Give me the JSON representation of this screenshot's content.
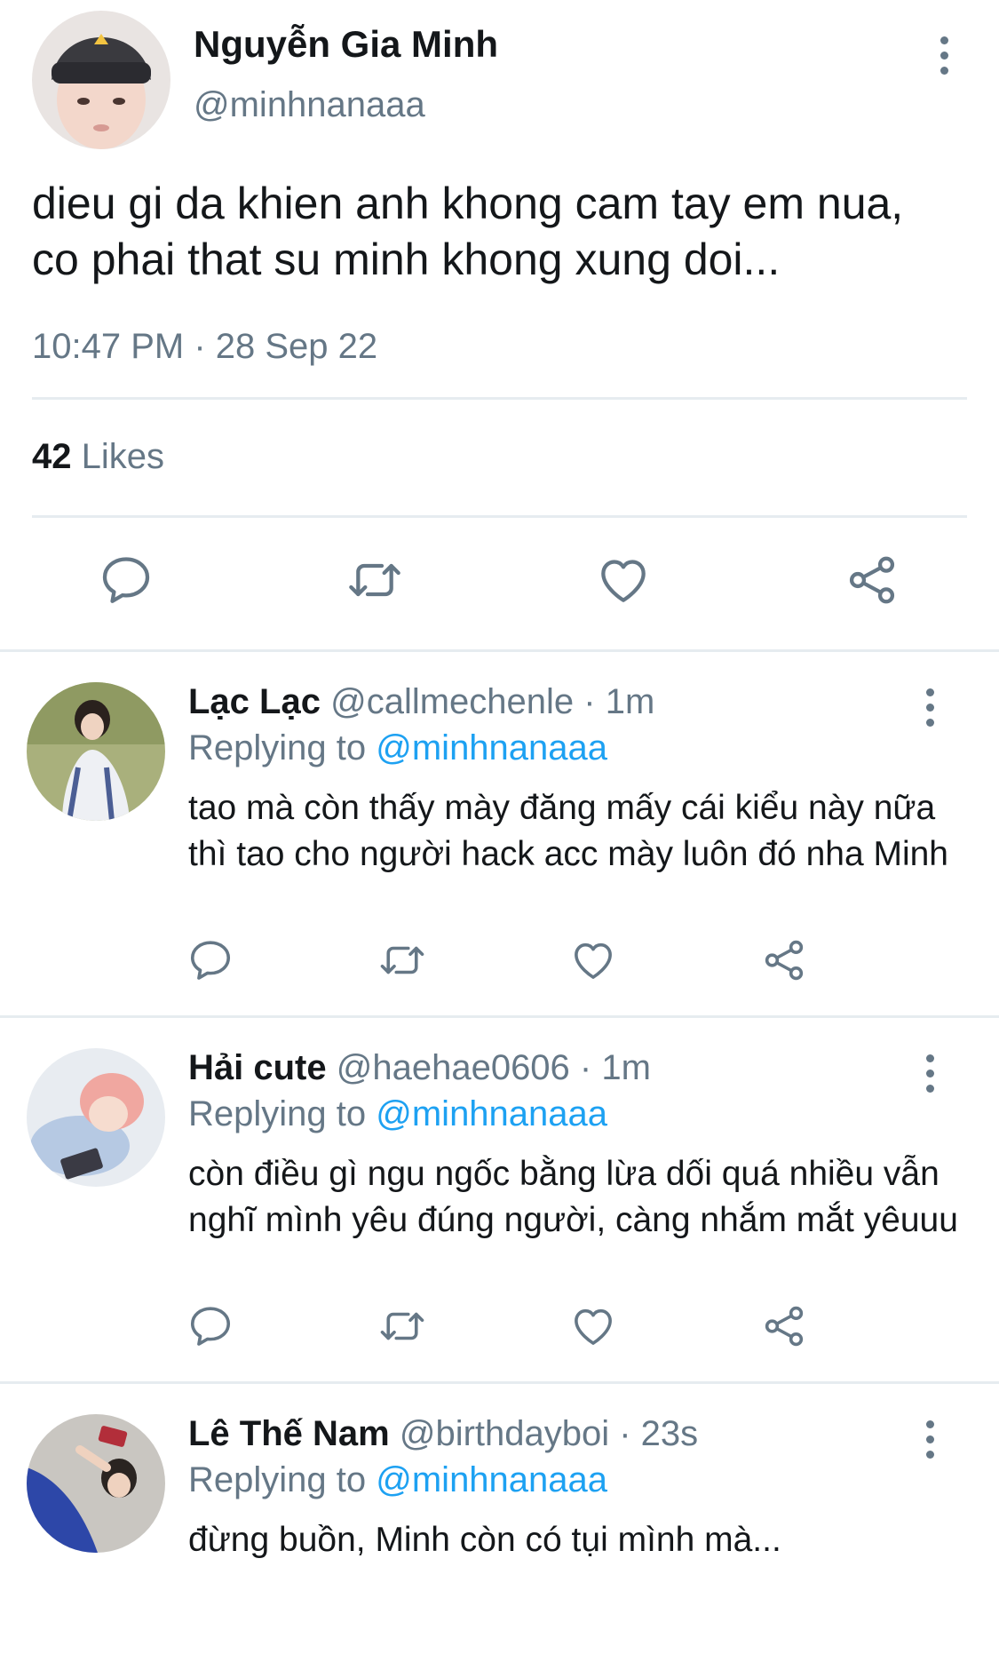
{
  "main_tweet": {
    "author_name": "Nguyễn Gia Minh",
    "handle": "@minhnanaaa",
    "text": "dieu gi da khien anh khong cam tay em nua, co phai that su minh khong xung doi...",
    "timestamp": "10:47 PM · 28 Sep 22",
    "likes_count": "42",
    "likes_label": "Likes",
    "actions": [
      "reply-icon",
      "retweet-icon",
      "like-icon",
      "share-icon"
    ]
  },
  "replies": [
    {
      "author_name": "Lạc Lạc",
      "meta": "@callmechenle · 1m",
      "replying_label": "Replying to",
      "replying_to": "@minhnanaaa",
      "text": "tao mà còn thấy mày đăng mấy cái kiểu này nữa thì tao cho người hack acc mày luôn đó nha Minh"
    },
    {
      "author_name": "Hải cute",
      "meta": "@haehae0606 · 1m",
      "replying_label": "Replying to",
      "replying_to": "@minhnanaaa",
      "text": "còn điều gì ngu ngốc bằng lừa dối quá nhiều vẫn nghĩ mình yêu đúng người, càng nhắm mắt yêuuu"
    },
    {
      "author_name": "Lê Thế Nam",
      "meta": "@birthdayboi · 23s",
      "replying_label": "Replying to",
      "replying_to": "@minhnanaaa",
      "text": "đừng buồn, Minh còn có tụi mình mà..."
    }
  ],
  "colors": {
    "text": "#14171a",
    "secondary": "#657786",
    "accent": "#1da1f2",
    "divider": "#e6ecf0"
  }
}
